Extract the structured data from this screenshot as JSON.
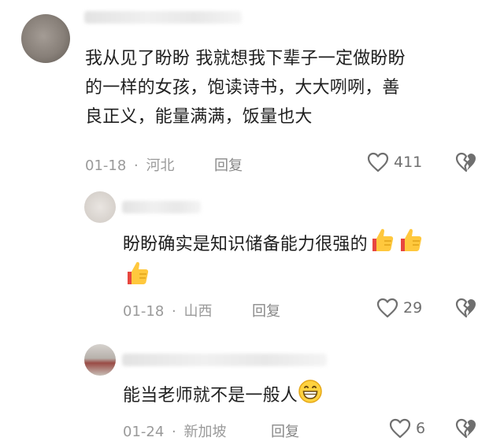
{
  "comments": [
    {
      "text_lines": [
        "我从见了盼盼 我就想我下辈子一定做盼盼",
        "的一样的女孩，饱读诗书，大大咧咧，善",
        "良正义，能量满满，饭量也大"
      ],
      "date": "01-18",
      "sep": "·",
      "location": "河北",
      "reply_label": "回复",
      "likes": "411"
    },
    {
      "text": "盼盼确实是知识储备能力很强的",
      "emoji": "thumbs-up",
      "emoji_count": 3,
      "date": "01-18",
      "sep": "·",
      "location": "山西",
      "reply_label": "回复",
      "likes": "29"
    },
    {
      "text": "能当老师就不是一般人",
      "emoji": "grinning-face",
      "date": "01-24",
      "sep": "·",
      "location": "新加坡",
      "reply_label": "回复",
      "likes": "6"
    }
  ],
  "colors": {
    "text": "#1f1f1f",
    "meta": "#9a9a9a",
    "icon": "#6f6f6f"
  }
}
